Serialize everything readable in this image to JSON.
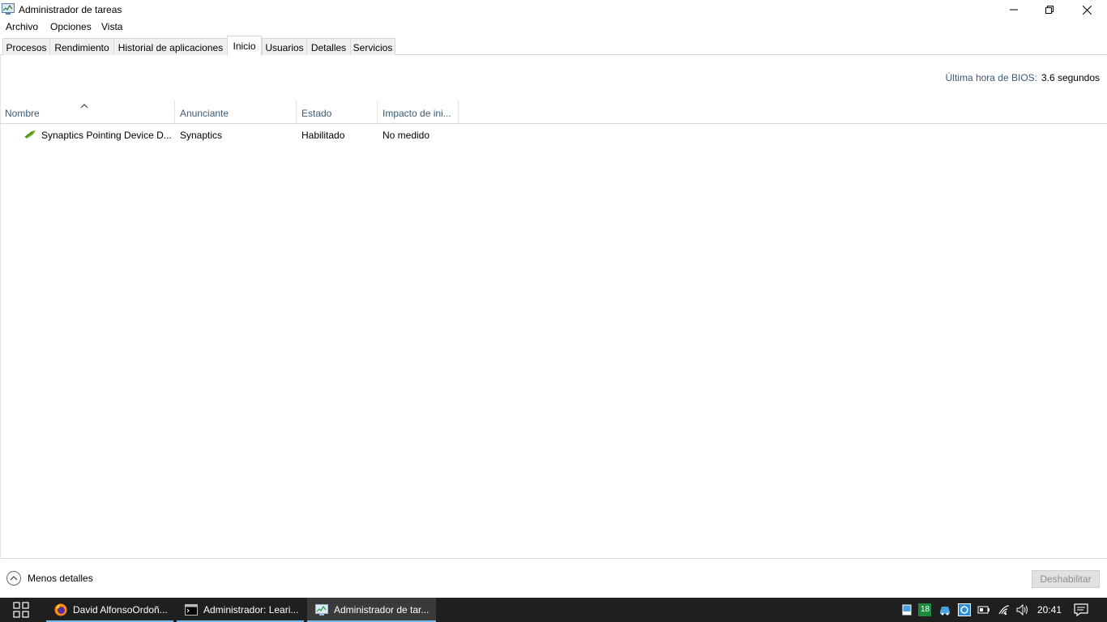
{
  "window": {
    "title": "Administrador de tareas"
  },
  "menu": {
    "items": [
      "Archivo",
      "Opciones",
      "Vista"
    ]
  },
  "tabs": [
    {
      "label": "Procesos",
      "active": false
    },
    {
      "label": "Rendimiento",
      "active": false
    },
    {
      "label": "Historial de aplicaciones",
      "active": false
    },
    {
      "label": "Inicio",
      "active": true
    },
    {
      "label": "Usuarios",
      "active": false
    },
    {
      "label": "Detalles",
      "active": false
    },
    {
      "label": "Servicios",
      "active": false
    }
  ],
  "bios": {
    "label": "Última hora de BIOS:",
    "value": "3.6 segundos"
  },
  "table": {
    "columns": [
      "Nombre",
      "Anunciante",
      "Estado",
      "Impacto de ini..."
    ],
    "sorted_column": "Nombre",
    "rows": [
      {
        "name": "Synaptics Pointing Device D...",
        "publisher": "Synaptics",
        "status": "Habilitado",
        "impact": "No medido",
        "icon": "synaptics-icon"
      }
    ]
  },
  "footer": {
    "less_details": "Menos detalles",
    "disable_button": "Deshabilitar"
  },
  "taskbar": {
    "apps": [
      {
        "label": "David AlfonsoOrdoñ...",
        "icon": "firefox-icon",
        "active": false
      },
      {
        "label": "Administrador:  Leari...",
        "icon": "cmd-icon",
        "active": false
      },
      {
        "label": "Administrador de tar...",
        "icon": "task-manager-icon",
        "active": true
      }
    ],
    "tray_badge": "18",
    "clock": "20:41"
  },
  "colors": {
    "header_text": "#3c5a77",
    "taskbar": "#1f1f1f",
    "accent": "#76b9ed"
  }
}
